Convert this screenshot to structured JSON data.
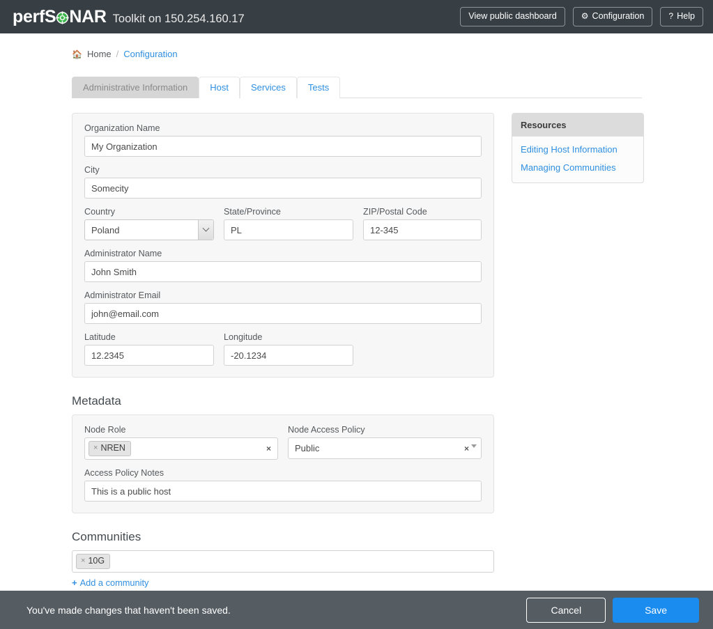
{
  "navbar": {
    "logo_pre": "perfS",
    "logo_post": "NAR",
    "logo_icon": "target-crosshair-icon",
    "subtitle": "Toolkit on 150.254.160.17",
    "buttons": [
      {
        "label": "View public dashboard",
        "icon": ""
      },
      {
        "label": "Configuration",
        "icon": "⚙"
      },
      {
        "label": "Help",
        "icon": "?"
      }
    ]
  },
  "breadcrumb": {
    "home_icon": "🏠",
    "home": "Home",
    "separator": "/",
    "current": "Configuration"
  },
  "tabs": [
    {
      "label": "Administrative Information",
      "active": true
    },
    {
      "label": "Host",
      "active": false
    },
    {
      "label": "Services",
      "active": false
    },
    {
      "label": "Tests",
      "active": false
    }
  ],
  "admin_form": {
    "organization_name": {
      "label": "Organization Name",
      "value": "My Organization"
    },
    "city": {
      "label": "City",
      "value": "Somecity"
    },
    "country": {
      "label": "Country",
      "value": "Poland"
    },
    "state_province": {
      "label": "State/Province",
      "value": "PL"
    },
    "zip_postal_code": {
      "label": "ZIP/Postal Code",
      "value": "12-345"
    },
    "administrator_name": {
      "label": "Administrator Name",
      "value": "John Smith"
    },
    "administrator_email": {
      "label": "Administrator Email",
      "value": "john@email.com"
    },
    "latitude": {
      "label": "Latitude",
      "value": "12.2345"
    },
    "longitude": {
      "label": "Longitude",
      "value": "-20.1234"
    }
  },
  "metadata": {
    "section_title": "Metadata",
    "node_role": {
      "label": "Node Role",
      "token": "NREN",
      "token_remove": "×",
      "clear": "×"
    },
    "node_access_policy": {
      "label": "Node Access Policy",
      "value": "Public",
      "clear": "×"
    },
    "access_policy_notes": {
      "label": "Access Policy Notes",
      "value": "This is a public host"
    }
  },
  "communities": {
    "section_title": "Communities",
    "token": "10G",
    "token_remove": "×",
    "add_link": "Add a community",
    "add_plus": "+"
  },
  "resources": {
    "title": "Resources",
    "links": [
      {
        "label": "Editing Host Information"
      },
      {
        "label": "Managing Communities"
      }
    ]
  },
  "savebar": {
    "message": "You've made changes that haven't been saved.",
    "cancel_label": "Cancel",
    "save_label": "Save"
  },
  "colors": {
    "navbar_bg": "#373f45",
    "logo_green": "#3cb54a",
    "link_blue": "#2f8fe0",
    "save_blue": "#1a8cf0",
    "savebar_bg": "#555d63",
    "panel_bg": "#f7f7f7",
    "active_tab_bg": "#d6d6d6"
  }
}
